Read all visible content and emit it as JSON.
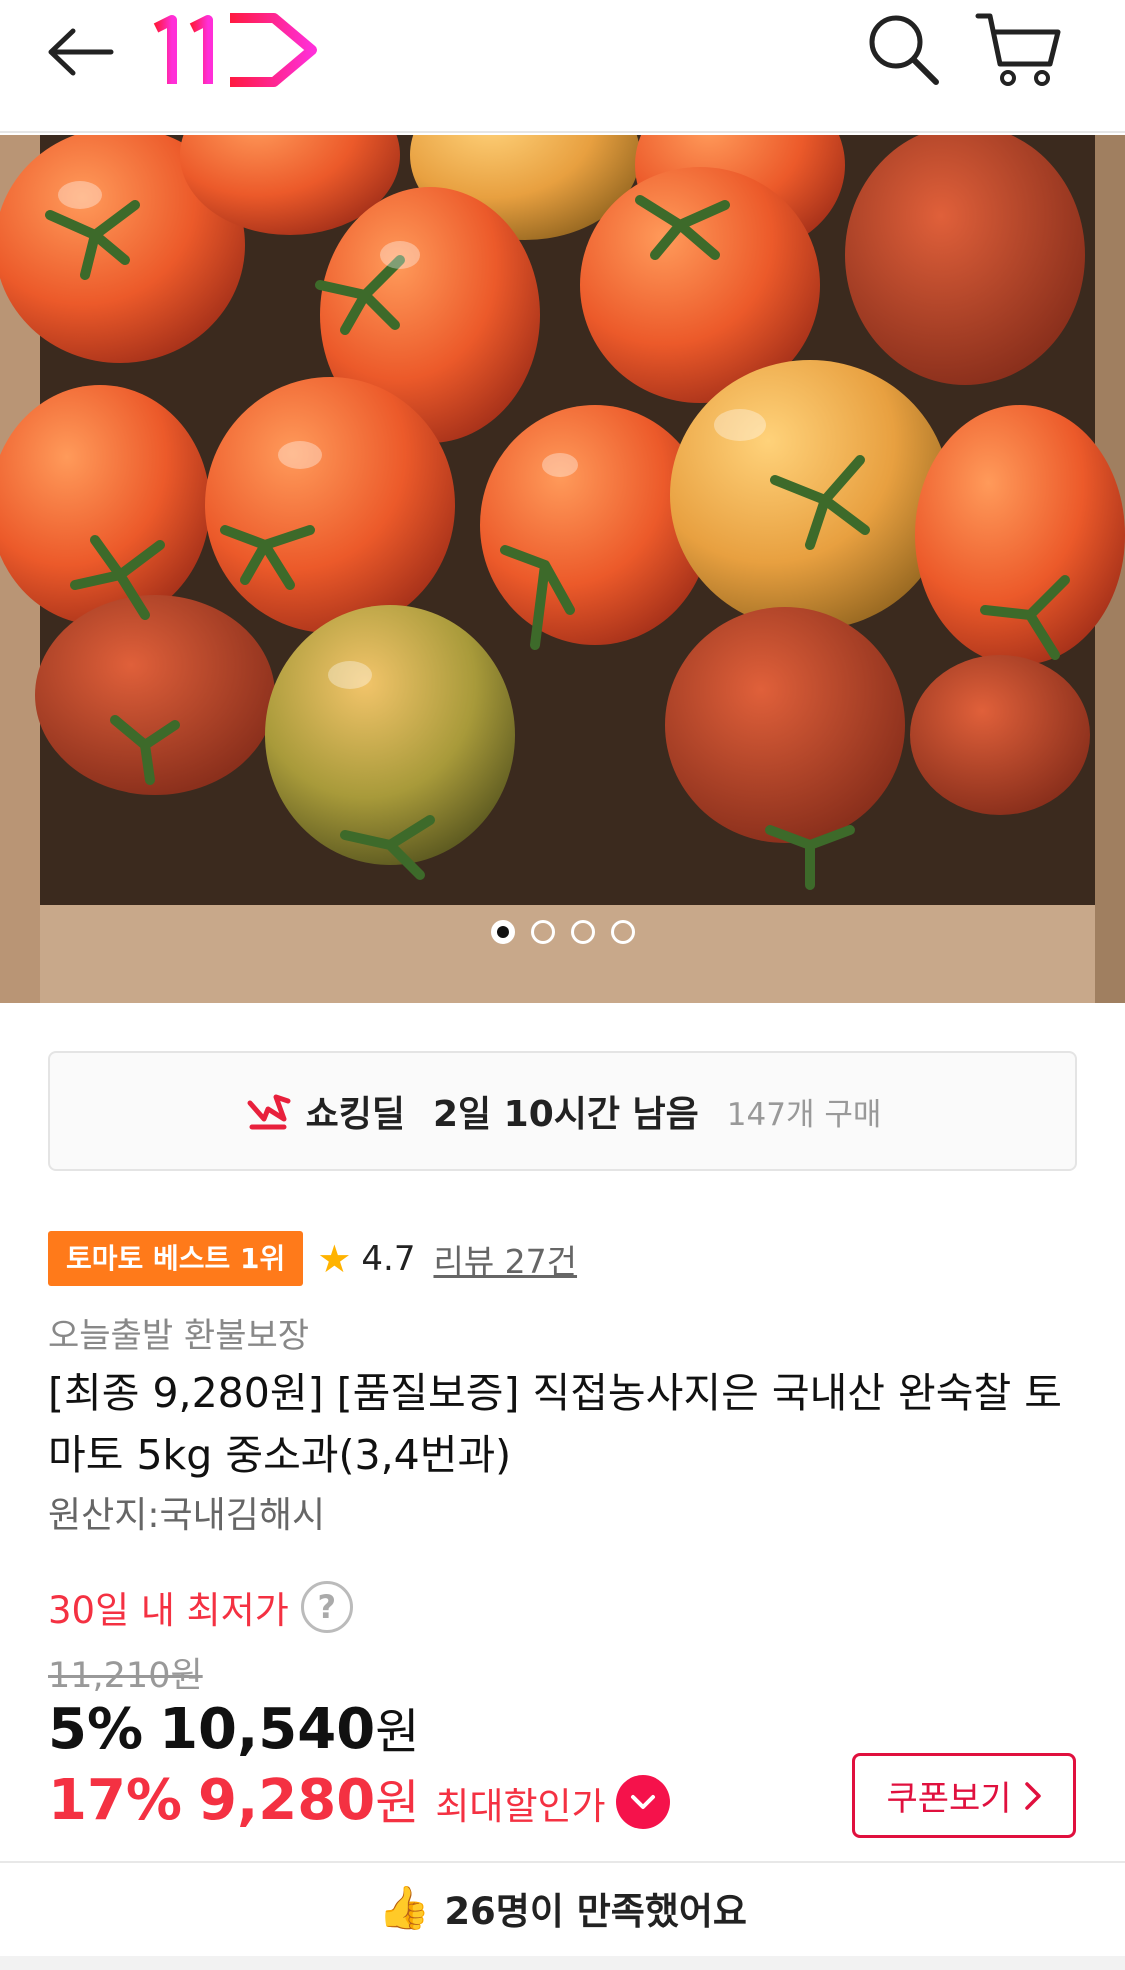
{
  "header": {
    "brand": "11",
    "back_label": "back",
    "colors": {
      "logo_gradient_start": "#ff1a40",
      "logo_gradient_end": "#ff2fd8"
    }
  },
  "gallery": {
    "image_subject": "tomatoes in a box",
    "page_count": 4,
    "active_index": 0
  },
  "deal": {
    "label": "쇼킹딜",
    "time_left": "2일 10시간 남음",
    "purchase_count": "147개 구매"
  },
  "product": {
    "best_badge": "토마토 베스트 1위",
    "rating": "4.7",
    "review_link": "리뷰 27건",
    "tags": "오늘출발 환불보장",
    "title": "[최종 9,280원] [품질보증] 직접농사지은 국내산 완숙찰 토마토 5kg 중소과(3,4번과)",
    "origin": "원산지:국내김해시"
  },
  "price": {
    "lowest_label": "30일 내 최저가",
    "help_symbol": "?",
    "original": "11,210원",
    "sale_percent": "5%",
    "sale_price": "10,540",
    "won": "원",
    "final_percent": "17%",
    "final_price": "9,280",
    "max_discount_label": "최대할인가",
    "coupon_button": "쿠폰보기",
    "accent_color": "#f43142"
  },
  "satisfaction": {
    "text": "26명이 만족했어요"
  }
}
